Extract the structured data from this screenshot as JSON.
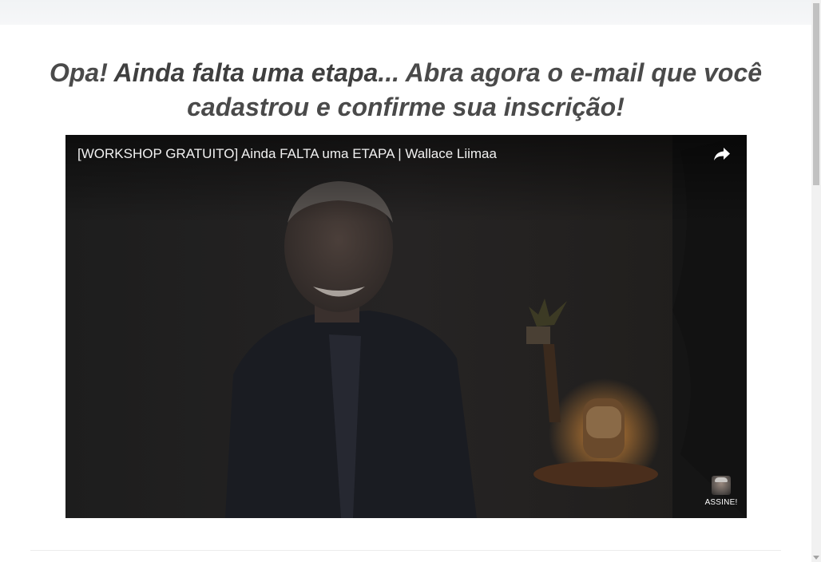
{
  "headline": {
    "part1": "Opa! ",
    "bold": "Ainda falta uma etapa",
    "part2": "... Abra agora o e-mail que você cadastrou e confirme sua inscrição!"
  },
  "video": {
    "title": "[WORKSHOP GRATUITO] Ainda FALTA uma ETAPA | Wallace Liimaa",
    "share_icon": "share-icon",
    "watermark_label": "ASSINE!"
  },
  "colors": {
    "headline_text": "#4a4a4a",
    "video_bg": "#1a1a1a",
    "scrollbar_thumb": "#c1c1c1"
  }
}
